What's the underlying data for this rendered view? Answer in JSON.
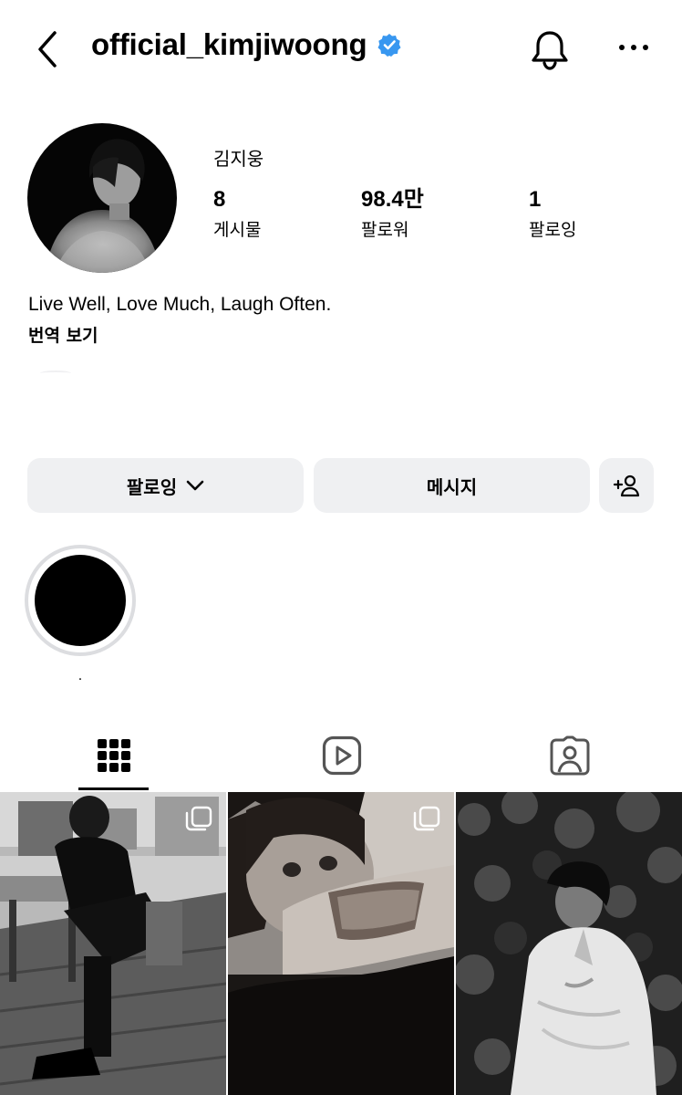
{
  "header": {
    "username": "official_kimjiwoong",
    "back_icon": "chevron-left-icon",
    "verified_icon": "verified-badge-icon",
    "bell_icon": "bell-icon",
    "more_icon": "more-horizontal-icon",
    "verified_color": "#3897f0"
  },
  "profile": {
    "display_name": "김지웅",
    "stats": {
      "posts": {
        "value": "8",
        "label": "게시물"
      },
      "followers": {
        "value": "98.4만",
        "label": "팔로워"
      },
      "following": {
        "value": "1",
        "label": "팔로잉"
      }
    },
    "bio": "Live Well, Love Much, Laugh Often.",
    "translate_link": "번역 보기"
  },
  "actions": {
    "following_label": "팔로잉",
    "message_label": "메시지",
    "add_user_icon": "add-user-icon"
  },
  "highlights": [
    {
      "label": "."
    }
  ],
  "tabs": [
    {
      "name": "posts",
      "icon": "grid-icon",
      "active": true
    },
    {
      "name": "reels",
      "icon": "reels-icon",
      "active": false
    },
    {
      "name": "tagged",
      "icon": "tagged-icon",
      "active": false
    }
  ],
  "posts": [
    {
      "id": "post-1",
      "multi": true
    },
    {
      "id": "post-2",
      "multi": true
    },
    {
      "id": "post-3",
      "multi": false
    }
  ]
}
